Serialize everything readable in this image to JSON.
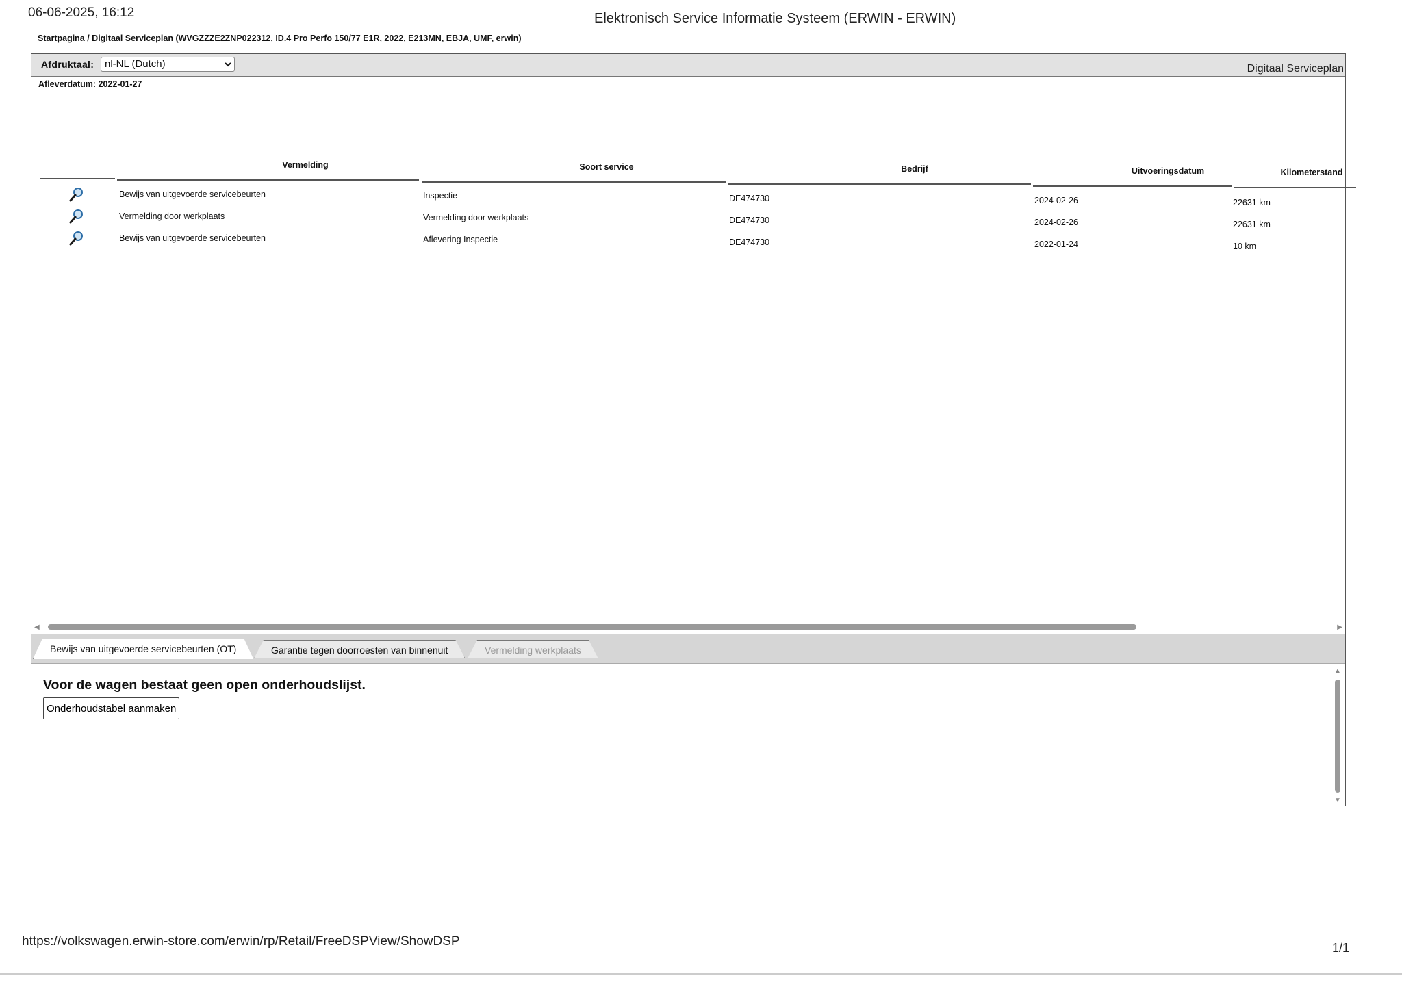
{
  "print_header": {
    "datetime": "06-06-2025, 16:12",
    "title": "Elektronisch Service Informatie Systeem (ERWIN - ERWIN)"
  },
  "breadcrumb": "Startpagina / Digitaal Serviceplan (WVGZZZE2ZNP022312, ID.4 Pro Perfo 150/77 E1R, 2022, E213MN, EBJA, UMF, erwin)",
  "toolbar": {
    "language_label": "Afdruktaal:",
    "language_value": "nl-NL (Dutch)",
    "page_title": "Digitaal Serviceplan"
  },
  "delivery_date": "Afleverdatum: 2022-01-27",
  "table": {
    "columns": [
      "Vermelding",
      "Soort service",
      "Bedrijf",
      "Uitvoeringsdatum",
      "Kilometerstand"
    ],
    "rows": [
      [
        "Bewijs van uitgevoerde servicebeurten",
        "Inspectie",
        "DE474730",
        "2024-02-26",
        "22631 km"
      ],
      [
        "Vermelding door werkplaats",
        "Vermelding door werkplaats",
        "DE474730",
        "2024-02-26",
        "22631 km"
      ],
      [
        "Bewijs van uitgevoerde servicebeurten",
        "Aflevering Inspectie",
        "DE474730",
        "2022-01-24",
        "10 km"
      ]
    ]
  },
  "tabs": [
    {
      "label": "Bewijs van uitgevoerde servicebeurten (OT)",
      "state": "active"
    },
    {
      "label": "Garantie tegen doorroesten van binnenuit",
      "state": "normal"
    },
    {
      "label": "Vermelding werkplaats",
      "state": "disabled"
    }
  ],
  "panel": {
    "message": "Voor de wagen bestaat geen open onderhoudslijst.",
    "button_label": "Onderhoudstabel aanmaken"
  },
  "footer": {
    "url": "https://volkswagen.erwin-store.com/erwin/rp/Retail/FreeDSPView/ShowDSP",
    "page": "1/1"
  },
  "icons": {
    "row_detail": "magnifier-icon",
    "select": "chevron-down-icon"
  },
  "colors": {
    "toolbar_bg": "#e2e2e2",
    "tabstrip_bg": "#d6d6d6",
    "magnifier_lens": "#4a8ec9"
  }
}
